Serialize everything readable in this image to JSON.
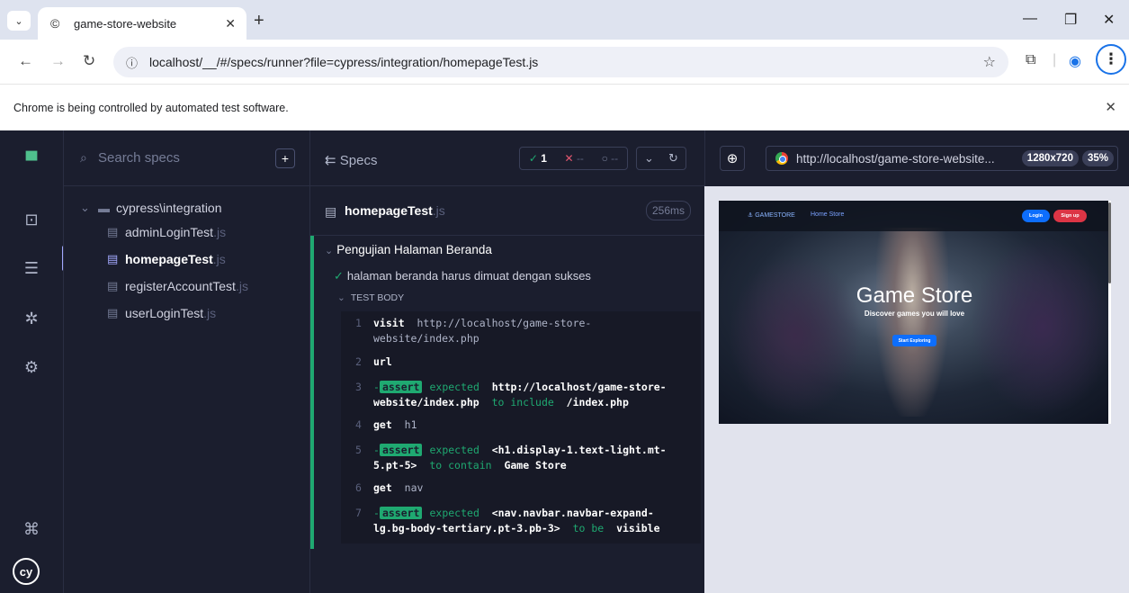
{
  "browser": {
    "tab_title": "game-store-website",
    "url": "localhost/__/#/specs/runner?file=cypress/integration/homepageTest.js",
    "infobar_message": "Chrome is being controlled by automated test software.",
    "icons": [
      "chevron-down-icon",
      "cypress-favicon-icon",
      "close-icon",
      "plus-icon",
      "minimize-icon",
      "restore-icon",
      "back-icon",
      "forward-icon",
      "reload-icon",
      "site-info-icon",
      "star-icon",
      "extensions-icon",
      "profile-icon",
      "more-vert-icon"
    ]
  },
  "cypress": {
    "search_placeholder": "Search specs",
    "folder": "cypress\\integration",
    "specs": [
      {
        "name": "adminLoginTest",
        "ext": ".js"
      },
      {
        "name": "homepageTest",
        "ext": ".js"
      },
      {
        "name": "registerAccountTest",
        "ext": ".js"
      },
      {
        "name": "userLoginTest",
        "ext": ".js"
      }
    ],
    "reporter": {
      "specs_label": "Specs",
      "passed": "1",
      "failed": "--",
      "pending": "--",
      "file_name": "homepageTest",
      "file_ext": ".js",
      "duration": "256ms",
      "suite_title": "Pengujian Halaman Beranda",
      "test_title": "halaman beranda harus dimuat dengan sukses",
      "test_body_label": "TEST BODY",
      "commands": [
        {
          "n": "1",
          "name": "visit",
          "msg": "http://localhost/game-store-website/index.php"
        },
        {
          "n": "2",
          "name": "url",
          "msg": ""
        },
        {
          "n": "3",
          "badge": "assert",
          "pre": "expected",
          "b1": "http://localhost/game-store-website/index.php",
          "mid": "to include",
          "b2": "/index.php"
        },
        {
          "n": "4",
          "name": "get",
          "msg": "h1"
        },
        {
          "n": "5",
          "badge": "assert",
          "pre": "expected",
          "b1": "<h1.display-1.text-light.mt-5.pt-5>",
          "mid": "to contain",
          "b2": "Game Store"
        },
        {
          "n": "6",
          "name": "get",
          "msg": "nav"
        },
        {
          "n": "7",
          "badge": "assert",
          "pre": "expected",
          "b1": "<nav.navbar.navbar-expand-lg.bg-body-tertiary.pt-3.pb-3>",
          "mid": "to be",
          "b2": "visible"
        }
      ]
    },
    "aut": {
      "url": "http://localhost/game-store-website...",
      "resolution": "1280x720",
      "zoom": "35%"
    },
    "site": {
      "brand": "GAMESTORE",
      "nav_links": "Home  Store",
      "login": "Login",
      "signup": "Sign up",
      "title": "Game Store",
      "subtitle": "Discover games you will love",
      "cta": "Start Exploring"
    }
  },
  "colors": {
    "pass": "#1fa971",
    "fail": "#e45770",
    "accent": "#a3a9ff",
    "panel": "#1b1e2e"
  }
}
